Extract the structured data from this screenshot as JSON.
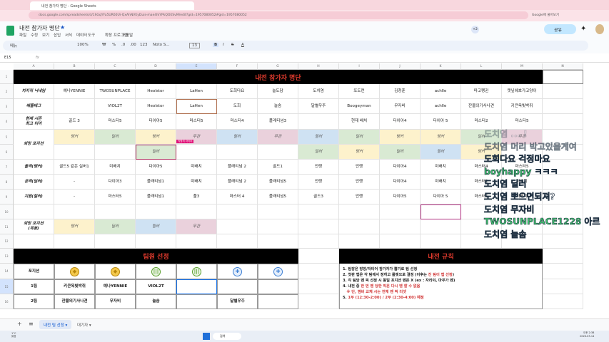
{
  "browser": {
    "tab_title": "내전 참가자 명단 - Google Sheets",
    "url": "docs.google.com/spreadsheets/d/1hGqYFa5UR60Ui-QxAhNVEyDuis-mae4hiYPkQOESvM/edit?gid=1957080052#gid=1957080052",
    "search_hint": "Google에 물어보기"
  },
  "app": {
    "title": "내전 참가자 명단",
    "menus": [
      "파일",
      "수정",
      "보기",
      "삽입",
      "서식",
      "데이터",
      "도구",
      "확장 프로그램",
      "도움말"
    ],
    "share_label": "공유",
    "collab_extra": "+2"
  },
  "toolbar": {
    "search": "메뉴",
    "zoom": "100%",
    "currency": "₩",
    "percent": "%",
    "dec1": ".0",
    "dec2": ".00",
    "fmt": "123",
    "font": "Noto S...",
    "font_size": "13"
  },
  "formula": {
    "cell_ref": "E15",
    "fx": "fx"
  },
  "columns": [
    "A",
    "B",
    "C",
    "D",
    "E",
    "F",
    "G",
    "H",
    "I",
    "J",
    "K",
    "L",
    "M",
    "N"
  ],
  "row_numbers": [
    "1",
    "2",
    "3",
    "4",
    "5",
    "6",
    "7",
    "8",
    "9",
    "10",
    "11",
    "12",
    "13",
    "14",
    "15",
    "16"
  ],
  "sheet": {
    "title": "내전 참가자 명단",
    "rows": [
      [
        "치지직 닉네임",
        "예나YENNIE",
        "TWOSUNPLACE",
        "Heolstor",
        "LaHen",
        "도희다요",
        "늘도담",
        "도치염",
        "또도런",
        "김청훈",
        "achlle",
        "마고펭귄",
        "캣닢에호가고양이"
      ],
      [
        "배틀태그",
        "",
        "VIOL2T",
        "Heolstor",
        "LaHen",
        "도희",
        "늘솜",
        "달별우주",
        "Boogeyman",
        "무자비",
        "achlle",
        "잔물의기사나견",
        "키큰옥빛박쥐"
      ],
      [
        "현재 시즌\n최고 티어",
        "골드 3",
        "마스터5",
        "다이아5",
        "마스터5",
        "마스터4",
        "플래티넘3",
        "",
        "현재 배치",
        "다이아4",
        "다이아 5",
        "마스터2",
        "마스터5"
      ],
      [
        "희망 포지션",
        "탱커",
        "딜러",
        "탱커",
        "무관",
        "힐러",
        "무관",
        "힐러",
        "딜러",
        "탱커",
        "탱커",
        "딜러",
        "무관"
      ],
      [
        "",
        "",
        "",
        "딜러",
        "",
        "",
        "",
        "딜러",
        "탱커",
        "딜러",
        "힐러",
        "탱커",
        ""
      ],
      [
        "돌격(탱커)",
        "골드5 같은 실버1",
        "미배치",
        "다이아5",
        "미배치",
        "플래티넘 2",
        "골드1",
        "언랭",
        "언랭",
        "다이아4",
        "미배치",
        "마스터4",
        "마스터5"
      ],
      [
        "공격(딜러)",
        "-",
        "다이아3",
        "플래티넘1",
        "미배치",
        "플래티넘 2",
        "플래티넘5",
        "언랭",
        "언랭",
        "다이아4",
        "미배치",
        "마스터2",
        "미배치"
      ],
      [
        "지원(힐러)",
        "-",
        "마스터5",
        "플래티넘1",
        "풀3",
        "마스터 4",
        "플래티넘5",
        "골드3",
        "언랭",
        "다이아5",
        "다이아 5",
        "마스터5",
        "미배치"
      ]
    ],
    "legend_label": "희망 포지션\n(목봉)",
    "legend": [
      "탱커",
      "딜러",
      "힐러",
      "무관"
    ],
    "cursor_tag": "익명의 라이더"
  },
  "team": {
    "title": "팀원 선정",
    "position_label": "포지션",
    "icons": [
      "tank-icon",
      "tank-icon",
      "dps-icon",
      "dps-icon",
      "healer-icon",
      "healer-icon"
    ],
    "rows": [
      [
        "1팀",
        "키큰옥빛박쥐",
        "예나YENNIE",
        "VIOL2T",
        "",
        "",
        ""
      ],
      [
        "2팀",
        "잔물의기사나견",
        "무자비",
        "늘솜",
        "",
        "달별우주",
        ""
      ]
    ]
  },
  "rules": {
    "title": "내전 규칙",
    "lines": [
      [
        {
          "t": "1. 팀장은 방장/저티어 참가자가 뽑기로 팀 선정",
          "r": false
        }
      ],
      [
        {
          "t": "2. 첫판 맵은 각 팀에서 정하고 룰렛으로 결정 (이후는 ",
          "r": false
        },
        {
          "t": "진 팀이 맵 선정",
          "r": true
        },
        {
          "t": ")",
          "r": false
        }
      ],
      [
        {
          "t": "3. 각 팀당 벤 픽 선정 시 동일 포지션 벤은 X (ex : 자리야, 마우가 벤)",
          "r": false
        }
      ],
      [
        {
          "t": "4. 내전 중 ",
          "r": false
        },
        {
          "t": "한 번 벤 당한 픽은 다시 벤 할 수 없음",
          "r": true
        }
      ],
      [
        {
          "t": "   ※ 단, 멤버 교체 시는 전체 벤 픽 리셋",
          "r": true
        }
      ],
      [
        {
          "t": "5. ",
          "r": false
        },
        {
          "t": "1부 (12:30-2:00) / 2부 (2:30-4:00) 예정",
          "r": true
        }
      ]
    ]
  },
  "chat": [
    {
      "name": "도치염",
      "msg": "... !"
    },
    {
      "name": "도치염",
      "msg": "머리 박고있을게여"
    },
    {
      "name": "도희다요",
      "msg": "걱정마요"
    },
    {
      "name": "boyhappy",
      "msg": "ㅋㅋㅋ"
    },
    {
      "name": "도치염",
      "msg": "딜러"
    },
    {
      "name": "도치염",
      "msg": "뽀으면되져?"
    },
    {
      "name": "도치염",
      "msg": "무자비"
    },
    {
      "name": "TWOSUNPLACE1228",
      "msg": "아르"
    },
    {
      "name": "도치염",
      "msg": "늘솜"
    }
  ],
  "sheet_tabs": {
    "active": "내전 팀 선정",
    "other": "대기자"
  },
  "taskbar": {
    "weather": "1°C\n맑음",
    "search": "검색",
    "time": "오후 2:38",
    "date": "2026-03-14"
  },
  "colors": {
    "tank": "#fdf2cc",
    "dps": "#d9ead3",
    "healer": "#cfe2f3",
    "any": "#ead1dc",
    "header_red": "#e23b2e"
  }
}
